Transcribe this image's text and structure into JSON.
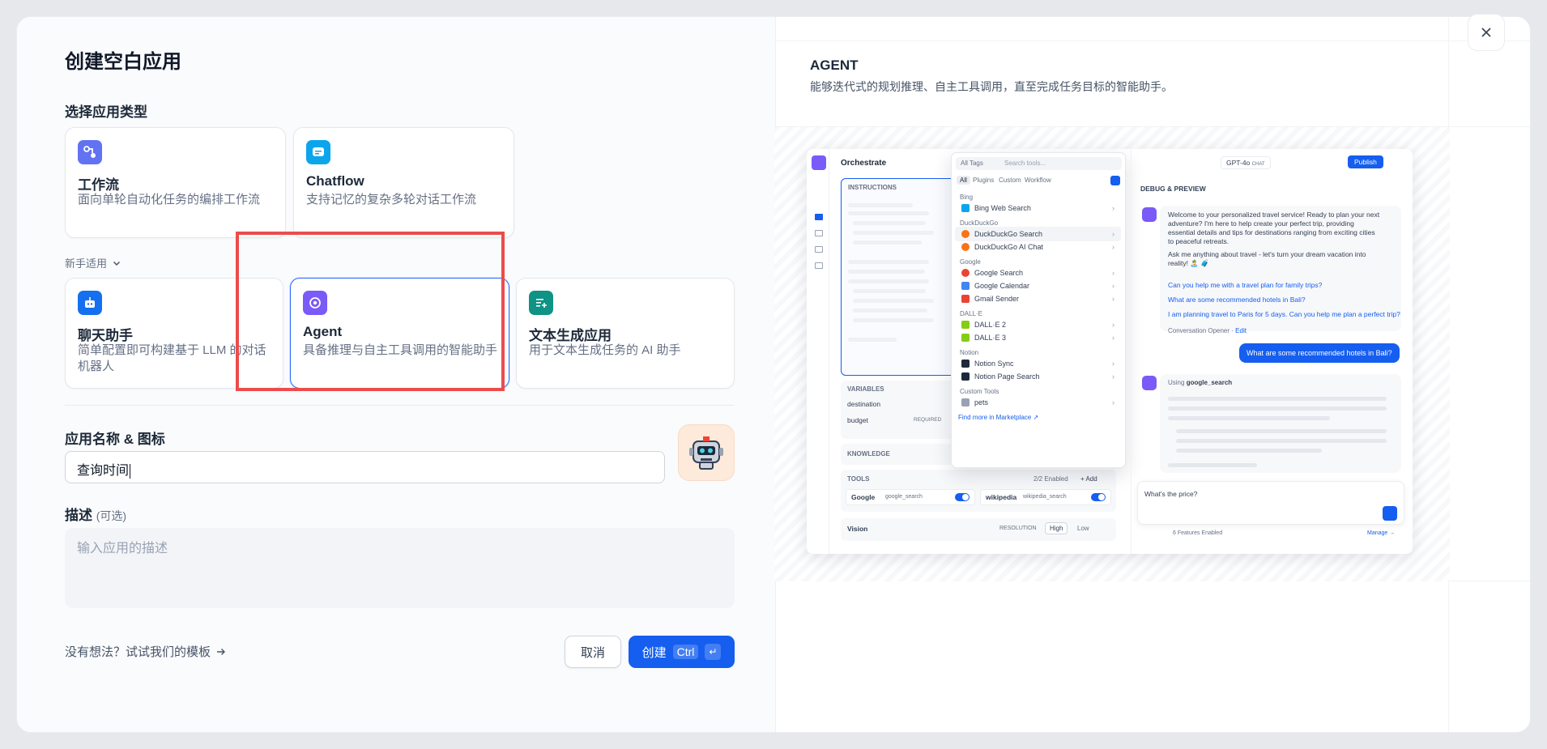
{
  "dialog": {
    "title": "创建空白应用",
    "type_section_label": "选择应用类型",
    "app_types": [
      {
        "name": "工作流",
        "desc": "面向单轮自动化任务的编排工作流",
        "icon": "workflow-icon",
        "color": "#6172f3"
      },
      {
        "name": "Chatflow",
        "desc": "支持记忆的复杂多轮对话工作流",
        "icon": "chatflow-icon",
        "color": "#0ba5ec"
      }
    ],
    "beginner_label": "新手适用",
    "beginner_types": [
      {
        "name": "聊天助手",
        "desc": "简单配置即可构建基于 LLM 的对话机器人",
        "icon": "chatbot-icon",
        "color": "#1570ef"
      },
      {
        "name": "Agent",
        "desc": "具备推理与自主工具调用的智能助手",
        "icon": "agent-icon",
        "color": "#7a5af8",
        "selected": true
      },
      {
        "name": "文本生成应用",
        "desc": "用于文本生成任务的 AI 助手",
        "icon": "text-generator-icon",
        "color": "#0e9384"
      }
    ],
    "name_icon_label": "应用名称 & 图标",
    "name_value": "查询时间",
    "desc_label": "描述",
    "desc_optional": "(可选)",
    "desc_placeholder": "输入应用的描述",
    "template_link": "没有想法？试试我们的模板",
    "cancel_label": "取消",
    "create_label": "创建",
    "create_kbd": "Ctrl",
    "create_kbd_enter": "↵"
  },
  "preview": {
    "title": "AGENT",
    "desc": "能够迭代式的规划推理、自主工具调用，直至完成任务目标的智能助手。",
    "shot": {
      "orchestrate": "Orchestrate",
      "instructions": "INSTRUCTIONS",
      "variables": "VARIABLES",
      "var_destination": "destination",
      "var_budget": "budget",
      "required": "REQUIRED",
      "knowledge": "KNOWLEDGE",
      "tools": "TOOLS",
      "tools_enabled": "2/2 Enabled",
      "add": "+ Add",
      "tool_google": "Google",
      "tool_google_id": "google_search",
      "tool_wiki": "wikipedia",
      "tool_wiki_id": "wikipedia_search",
      "vision": "Vision",
      "resolution": "RESOLUTION",
      "high": "High",
      "low": "Low",
      "all_tags": "All Tags",
      "search_tools": "Search tools...",
      "filter_all": "All",
      "filter_plugins": "Plugins",
      "filter_custom": "Custom",
      "filter_workflow": "Workflow",
      "groups": [
        {
          "group": "Bing",
          "items": [
            "Bing Web Search"
          ]
        },
        {
          "group": "DuckDuckGo",
          "items": [
            "DuckDuckGo Search",
            "DuckDuckGo AI Chat"
          ]
        },
        {
          "group": "Google",
          "items": [
            "Google Search",
            "Google Calendar",
            "Gmail Sender"
          ]
        },
        {
          "group": "DALL·E",
          "items": [
            "DALL·E 2",
            "DALL·E 3"
          ]
        },
        {
          "group": "Notion",
          "items": [
            "Notion Sync",
            "Notion Page Search"
          ]
        },
        {
          "group": "Custom Tools",
          "items": [
            "pets"
          ]
        }
      ],
      "marketplace": "Find more in Marketplace ↗",
      "model": "GPT-4o",
      "chat_tag": "CHAT",
      "publish": "Publish",
      "debug": "DEBUG & PREVIEW",
      "welcome1": "Welcome to your personalized travel service! Ready to plan your next",
      "welcome2": "adventure? I'm here to help create your perfect trip, providing",
      "welcome3": "essential details and tips for destinations ranging from exciting cities",
      "welcome4": "to peaceful retreats.",
      "welcome5": "Ask me anything about travel - let's turn your dream vacation into",
      "welcome6": "reality! 🏝️ 🧳",
      "suggestions": [
        "Can you help me with a travel plan for family trips?",
        "What are some recommended hotels in Bali?",
        "I am planning travel to Paris for 5 days. Can you help me plan a perfect trip?"
      ],
      "opener": "Conversation Opener",
      "edit": "Edit",
      "user_msg": "What are some recommended hotels in Bali?",
      "using": "Using",
      "using_tool": "google_search",
      "input_text": "What's the price?",
      "features": "6 Features Enabled",
      "manage": "Manage →"
    }
  }
}
